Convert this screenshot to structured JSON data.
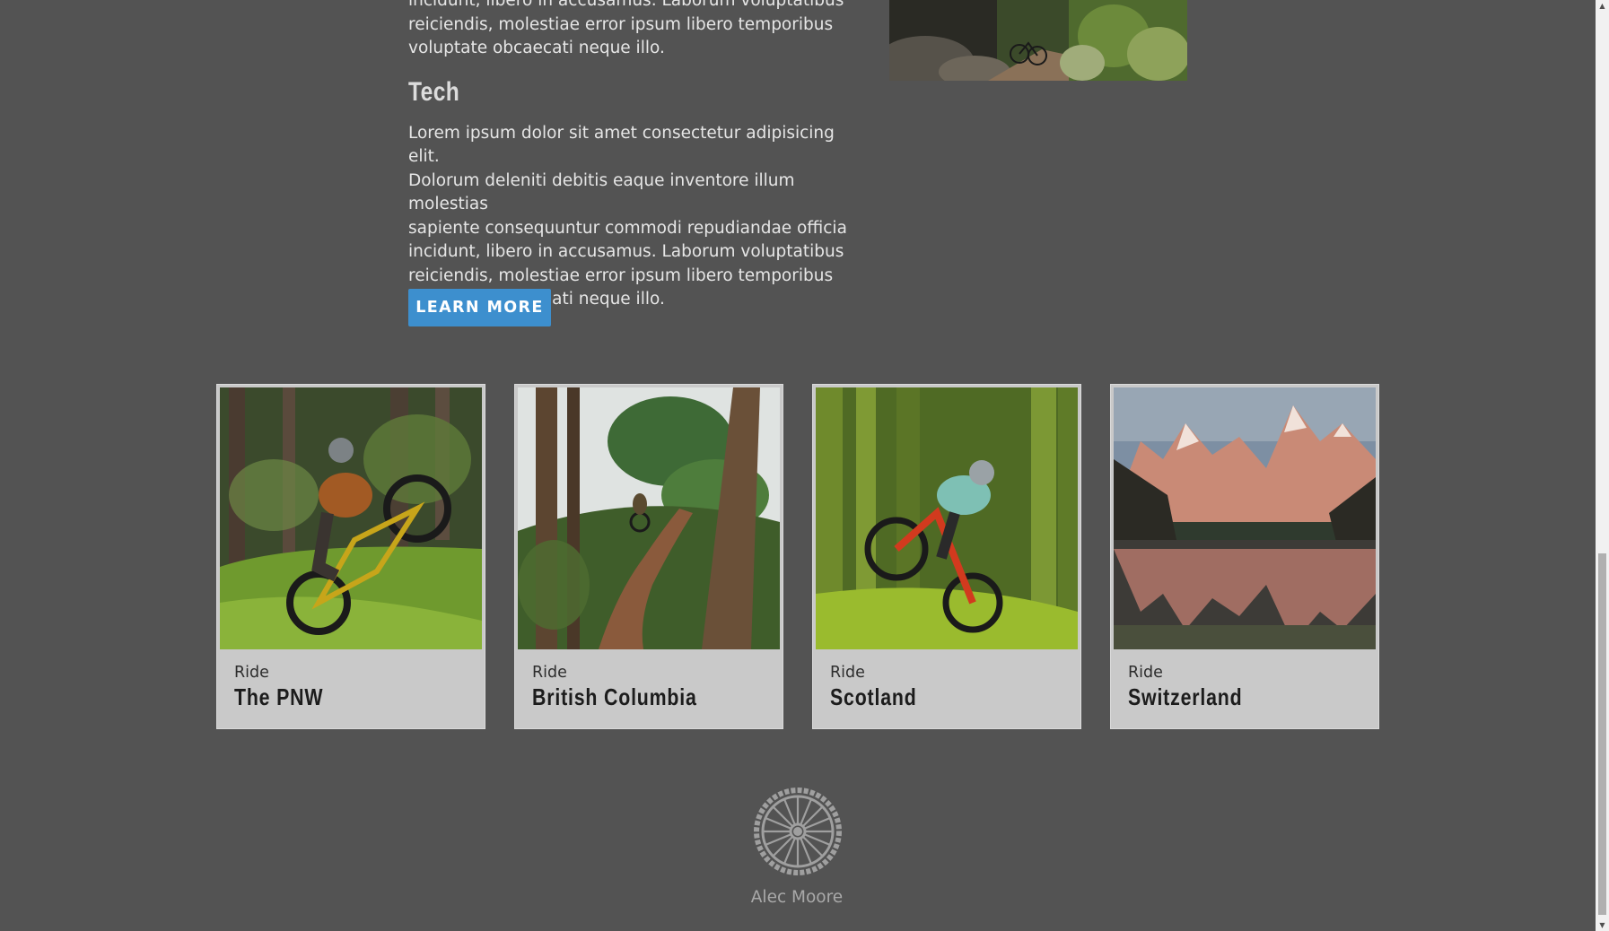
{
  "content": {
    "intro_paragraph_tail": "incidunt, libero in accusamus. Laborum voluptatibus\nreiciendis, molestiae error ipsum libero temporibus\nvoluptate obcaecati neque illo.",
    "tech_heading": "Tech",
    "tech_paragraph": "Lorem ipsum dolor sit amet consectetur adipisicing elit.\nDolorum deleniti debitis eaque inventore illum molestias\nsapiente consequuntur commodi repudiandae officia\nincidunt, libero in accusamus. Laborum voluptatibus\nreiciendis, molestiae error ipsum libero temporibus\nvoluptate obcaecati neque illo.",
    "learn_more_label": "LEARN MORE"
  },
  "cards": [
    {
      "kicker": "Ride",
      "title": "The PNW"
    },
    {
      "kicker": "Ride",
      "title": "British Columbia"
    },
    {
      "kicker": "Ride",
      "title": "Scotland"
    },
    {
      "kicker": "Ride",
      "title": "Switzerland"
    }
  ],
  "footer": {
    "logo_icon": "bike-wheel-icon",
    "name": "Alec Moore"
  },
  "colors": {
    "page_background": "#535353",
    "button_accent": "#3d8fce",
    "card_background": "#c9c9c9"
  }
}
